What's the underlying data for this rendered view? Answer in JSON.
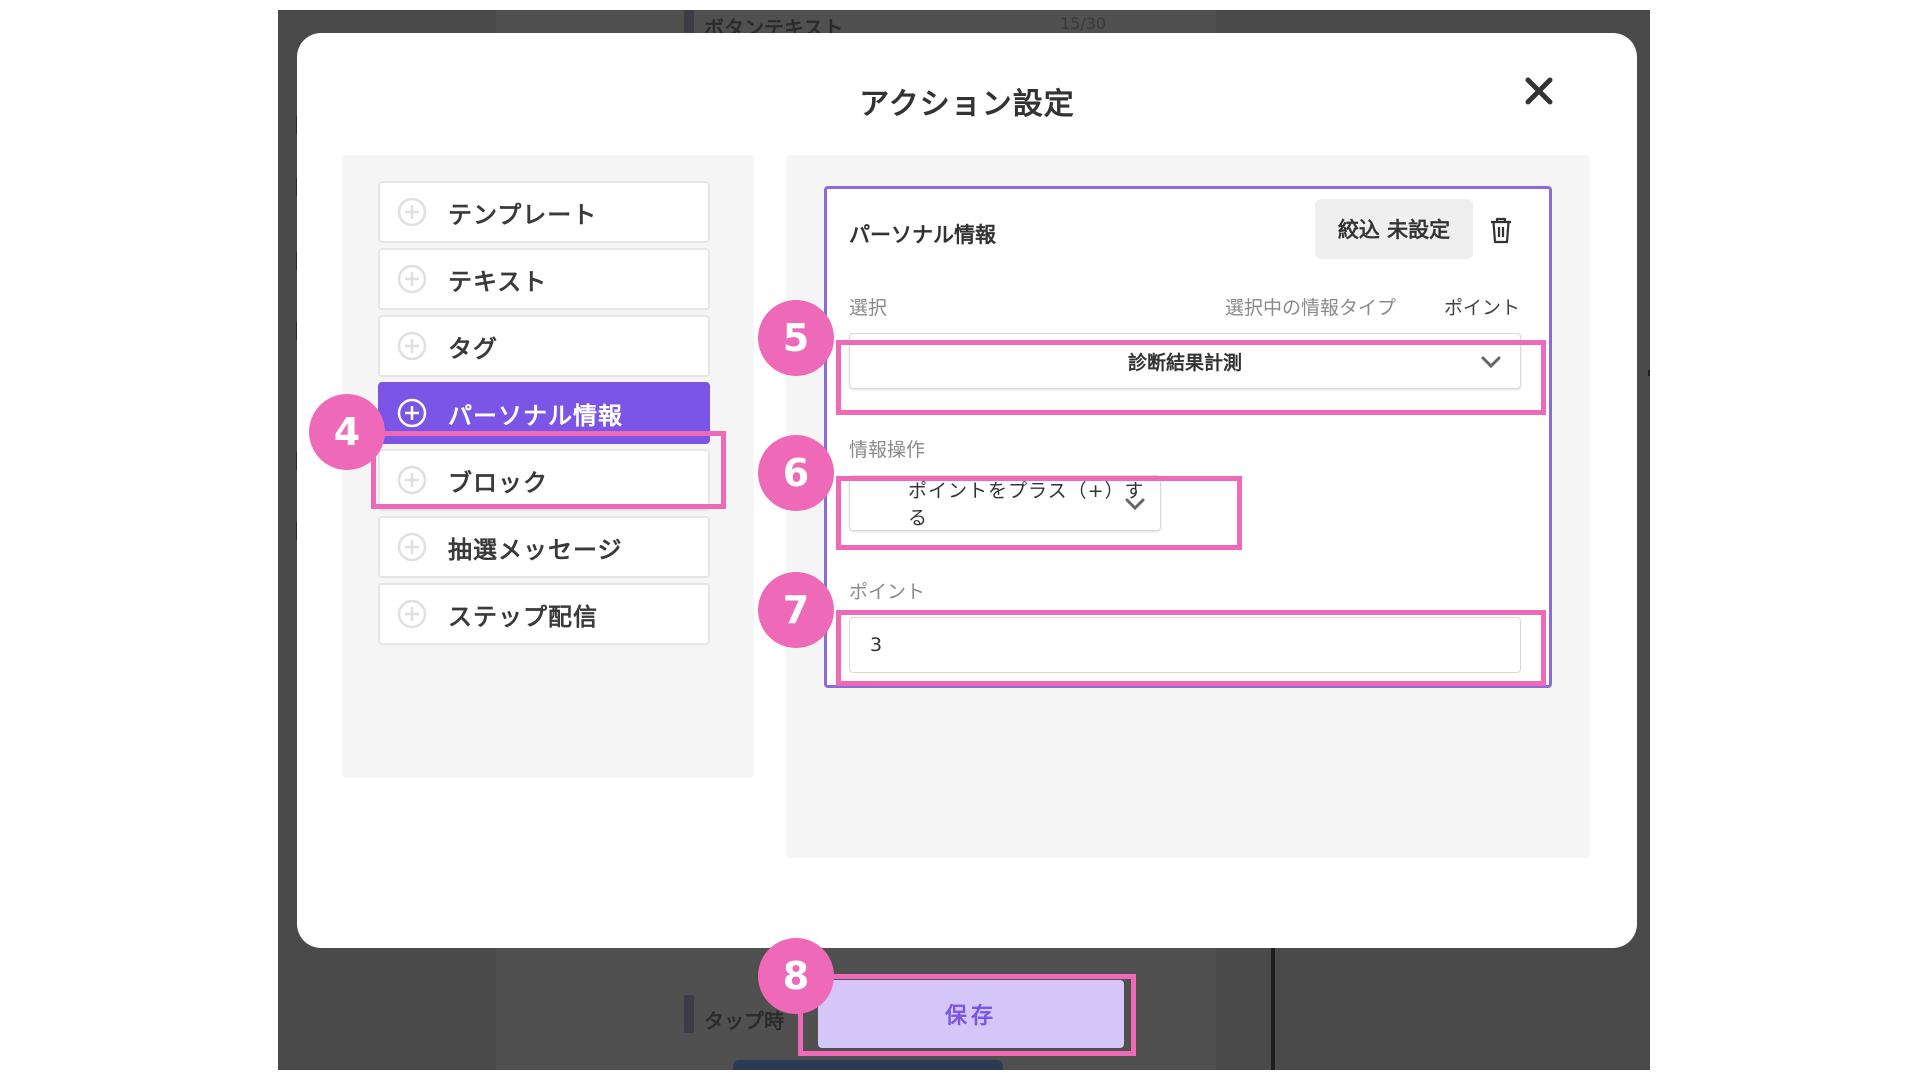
{
  "background": {
    "button_text_label": "ボタンテキスト",
    "button_text_count": "15/30",
    "tap_label": "タップ時"
  },
  "modal": {
    "title": "アクション設定"
  },
  "actions": [
    {
      "label": "テンプレート",
      "icon": "plus-circle-icon",
      "active": false
    },
    {
      "label": "テキスト",
      "icon": "plus-circle-icon",
      "active": false
    },
    {
      "label": "タグ",
      "icon": "plus-circle-icon",
      "active": false
    },
    {
      "label": "パーソナル情報",
      "icon": "plus-circle-icon",
      "active": true
    },
    {
      "label": "ブロック",
      "icon": "plus-circle-icon",
      "active": false
    },
    {
      "label": "抽選メッセージ",
      "icon": "plus-circle-icon",
      "active": false
    },
    {
      "label": "ステップ配信",
      "icon": "plus-circle-icon",
      "active": false
    }
  ],
  "card": {
    "title": "パーソナル情報",
    "filter_button": "絞込 未設定",
    "select_label": "選択",
    "info_type_label": "選択中の情報タイプ",
    "info_type_value": "ポイント",
    "select_value": "診断結果計測",
    "operation_label": "情報操作",
    "operation_value": "ポイントをプラス（+）する",
    "point_label": "ポイント",
    "point_value": "3"
  },
  "save_button": "保存",
  "steps": [
    "4",
    "5",
    "6",
    "7",
    "8"
  ],
  "colors": {
    "accent": "#7a55e6",
    "highlight": "#ee6ab8",
    "save_bg": "#d4c6f7"
  }
}
